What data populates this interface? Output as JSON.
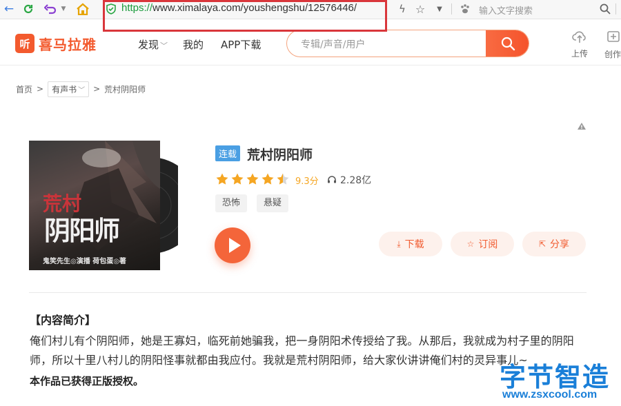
{
  "browser": {
    "url_scheme": "https://",
    "url_rest": "www.ximalaya.com/youshengshu/12576446/",
    "search_placeholder": "输入文字搜索"
  },
  "header": {
    "logo_mark": "听",
    "logo_text": "喜马拉雅",
    "nav": [
      "发现",
      "我的",
      "APP下载"
    ],
    "search_placeholder": "专辑/声音/用户",
    "upload_label": "上传",
    "create_label": "创作"
  },
  "breadcrumb": {
    "home": "首页",
    "category": "有声书",
    "current": "荒村阴阳师",
    "separator": ">"
  },
  "album": {
    "cover_title_top": "荒村",
    "cover_title_main": "阴阳师",
    "cover_credit": "鬼笑先生◎演播   荷包蛋◎著",
    "status_badge": "连载",
    "title": "荒村阴阳师",
    "rating_stars": 4.5,
    "score": "9.3分",
    "plays": "2.28亿",
    "tags": [
      "恐怖",
      "悬疑"
    ],
    "actions": {
      "download": "下载",
      "subscribe": "订阅",
      "share": "分享"
    }
  },
  "intro": {
    "title": "【内容简介】",
    "text": "俺们村儿有个阴阳师，她是王寡妇，临死前她骗我，把一身阴阳术传授给了我。从那后，我就成为村子里的阴阳师，所以十里八村儿的阴阳怪事就都由我应付。我就是荒村阴阳师，给大家伙讲讲俺们村的灵异事儿~",
    "note": "本作品已获得正版授权。"
  },
  "watermark": {
    "brand": "字节智造",
    "url": "www.zsxcool.com"
  },
  "colors": {
    "brand": "#f35a2e",
    "badge": "#4a9fe3",
    "star": "#f5a623",
    "url_highlight": "#d9363b",
    "watermark": "#1a7fd8"
  }
}
